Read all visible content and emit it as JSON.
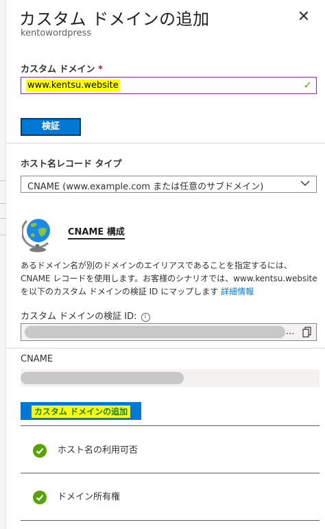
{
  "panel": {
    "title": "カスタム ドメインの追加",
    "subtitle": "kentowordpress",
    "close_icon": "close-icon"
  },
  "custom_domain": {
    "label": "カスタム ドメイン",
    "required_mark": "*",
    "value": "www.kentsu.website",
    "valid_icon": "checkmark-icon"
  },
  "verify_button": {
    "label": "検証"
  },
  "record_type": {
    "label": "ホスト名レコード タイプ",
    "selected": "CNAME (www.example.com または任意のサブドメイン)"
  },
  "cname_section": {
    "heading": "CNAME 構成",
    "description": "あるドメイン名が別のドメインのエイリアスであることを指定するには、CNAME レコードを使用します。お客様のシナリオでは、www.kentsu.website を以下のカスタム ドメインの検証 ID にマップします",
    "link": "詳細情報"
  },
  "verification_id": {
    "label": "カスタム ドメインの検証 ID:",
    "info_icon": "info-icon",
    "ellipsis": "...",
    "copy_icon": "copy-icon"
  },
  "cname": {
    "label": "CNAME"
  },
  "add_button": {
    "label": "カスタム ドメインの追加"
  },
  "checks": [
    {
      "label": "ホスト名の利用可否",
      "icon": "checkmark-circle-icon"
    },
    {
      "label": "ドメイン所有権",
      "icon": "checkmark-circle-icon"
    }
  ],
  "colors": {
    "accent": "#0078d4",
    "success": "#57a300",
    "highlight": "#ffff00"
  }
}
